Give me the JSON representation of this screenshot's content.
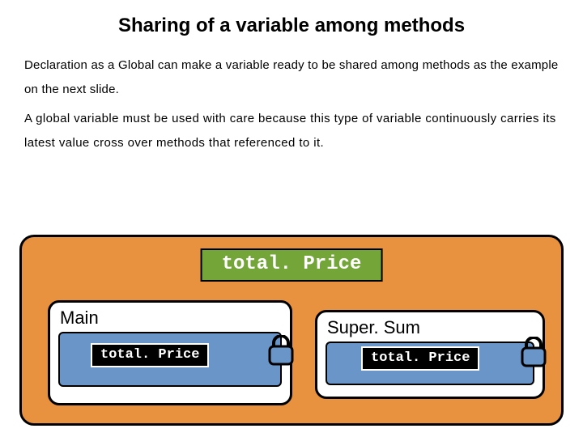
{
  "title": "Sharing of a variable among methods",
  "paragraph1": "Declaration as a Global can make a variable ready to be shared among methods as the example on the next slide.",
  "paragraph2": "A global variable must be used with care because this type of variable continuously carries its latest value cross over methods that referenced to it.",
  "diagram": {
    "global_var": "total. Price",
    "box1": {
      "label": "Main",
      "var": "total. Price"
    },
    "box2": {
      "label": "Super. Sum",
      "var": "total. Price"
    }
  }
}
